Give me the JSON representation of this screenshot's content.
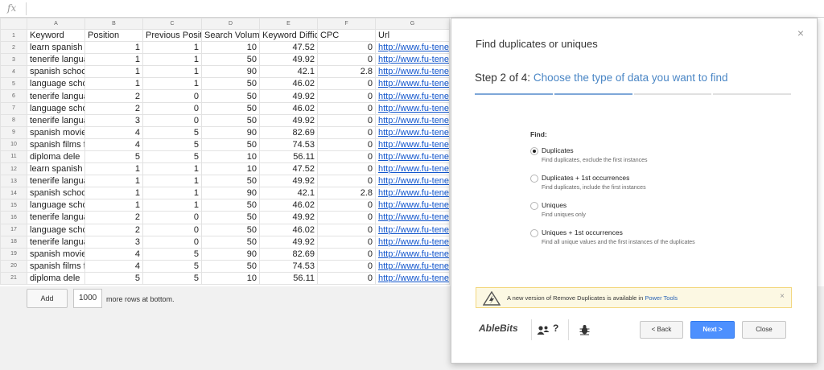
{
  "formula_bar": {
    "fx_label": "fx"
  },
  "sheet": {
    "column_letters": [
      "A",
      "B",
      "C",
      "D",
      "E",
      "F",
      "G"
    ],
    "headers": [
      "Keyword",
      "Position",
      "Previous Position",
      "Search Volume",
      "Keyword Difficulty",
      "CPC",
      "Url"
    ],
    "rows": [
      [
        "learn spanish in t",
        "1",
        "1",
        "10",
        "47.52",
        "0",
        "http://www.fu-tenerife"
      ],
      [
        "tenerife language",
        "1",
        "1",
        "50",
        "49.92",
        "0",
        "http://www.fu-tenerife"
      ],
      [
        "spanish school te",
        "1",
        "1",
        "90",
        "42.1",
        "2.8",
        "http://www.fu-tenerife"
      ],
      [
        "language school",
        "1",
        "1",
        "50",
        "46.02",
        "0",
        "http://www.fu-tenerife"
      ],
      [
        "tenerife language",
        "2",
        "0",
        "50",
        "49.92",
        "0",
        "http://www.fu-tenerife"
      ],
      [
        "language school",
        "2",
        "0",
        "50",
        "46.02",
        "0",
        "http://www.fu-tenerife"
      ],
      [
        "tenerife language",
        "3",
        "0",
        "50",
        "49.92",
        "0",
        "http://www.fu-tenerife"
      ],
      [
        "spanish movie fo",
        "4",
        "5",
        "90",
        "82.69",
        "0",
        "http://www.fu-tenerife"
      ],
      [
        "spanish films for",
        "4",
        "5",
        "50",
        "74.53",
        "0",
        "http://www.fu-tenerife"
      ],
      [
        "diploma dele",
        "5",
        "5",
        "10",
        "56.11",
        "0",
        "http://www.fu-tenerife"
      ],
      [
        "learn spanish in t",
        "1",
        "1",
        "10",
        "47.52",
        "0",
        "http://www.fu-tenerife"
      ],
      [
        "tenerife language",
        "1",
        "1",
        "50",
        "49.92",
        "0",
        "http://www.fu-tenerife"
      ],
      [
        "spanish school te",
        "1",
        "1",
        "90",
        "42.1",
        "2.8",
        "http://www.fu-tenerife"
      ],
      [
        "language school",
        "1",
        "1",
        "50",
        "46.02",
        "0",
        "http://www.fu-tenerife"
      ],
      [
        "tenerife language",
        "2",
        "0",
        "50",
        "49.92",
        "0",
        "http://www.fu-tenerife"
      ],
      [
        "language school",
        "2",
        "0",
        "50",
        "46.02",
        "0",
        "http://www.fu-tenerife"
      ],
      [
        "tenerife language",
        "3",
        "0",
        "50",
        "49.92",
        "0",
        "http://www.fu-tenerife"
      ],
      [
        "spanish movie fo",
        "4",
        "5",
        "90",
        "82.69",
        "0",
        "http://www.fu-tenerife"
      ],
      [
        "spanish films for",
        "4",
        "5",
        "50",
        "74.53",
        "0",
        "http://www.fu-tenerife"
      ],
      [
        "diploma dele",
        "5",
        "5",
        "10",
        "56.11",
        "0",
        "http://www.fu-tenerife"
      ]
    ]
  },
  "add_rows": {
    "button_label": "Add",
    "count": "1000",
    "suffix": "more rows at bottom."
  },
  "dialog": {
    "title": "Find duplicates or uniques",
    "close_icon": "×",
    "step_prefix": "Step 2 of 4:",
    "step_subtitle": "Choose the type of data you want to find",
    "progress_steps": 4,
    "progress_done": 2,
    "find_label": "Find:",
    "options": [
      {
        "title": "Duplicates",
        "desc": "Find duplicates, exclude the first instances",
        "selected": true
      },
      {
        "title": "Duplicates + 1st occurrences",
        "desc": "Find duplicates, include the first instances",
        "selected": false
      },
      {
        "title": "Uniques",
        "desc": "Find uniques only",
        "selected": false
      },
      {
        "title": "Uniques + 1st occurrences",
        "desc": "Find all unique values and the first instances of the duplicates",
        "selected": false
      }
    ],
    "notice": {
      "text": "A new version of Remove Duplicates is available in ",
      "link": "Power Tools",
      "close": "×"
    },
    "footer": {
      "logo": "AbleBits",
      "help": "?",
      "back": "< Back",
      "next": "Next >",
      "close": "Close"
    },
    "colors": {
      "accent": "#4a86c5",
      "progress_active": "#7ea7d8",
      "progress_idle": "#e0e0e0"
    }
  }
}
